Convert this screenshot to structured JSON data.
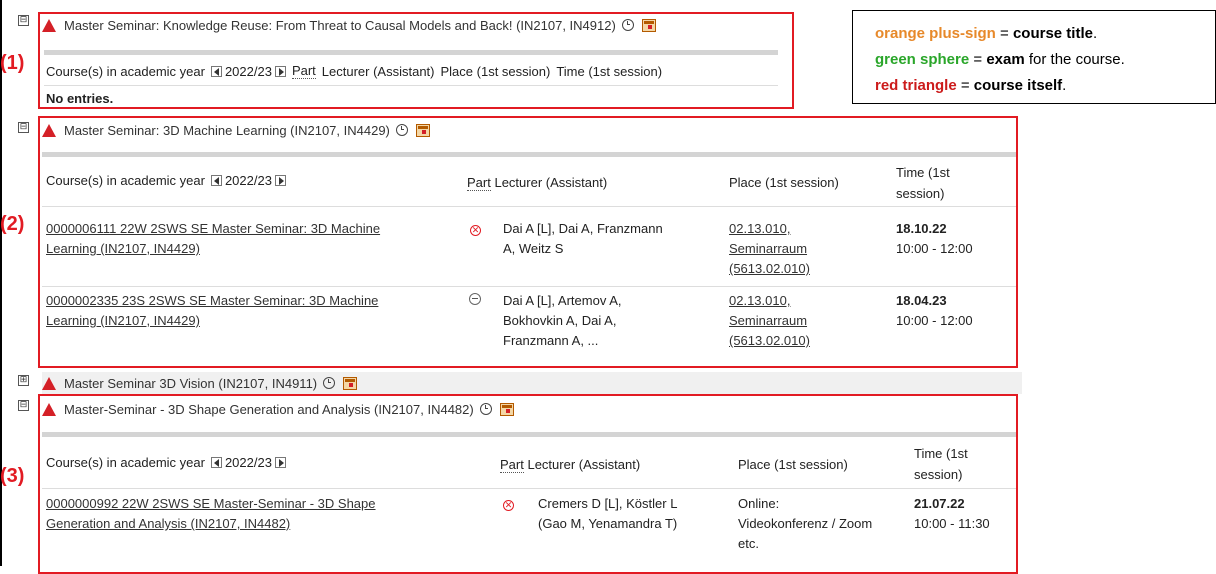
{
  "colors": {
    "accent_red": "#e21b23",
    "orange": "#e7892a",
    "green": "#2aa62a",
    "red_text": "#cc1b1b"
  },
  "icons": {
    "toggle_minus": "minus-square-icon",
    "toggle_plus": "plus-square-icon",
    "triangle": "red-triangle-icon",
    "clock": "clock-icon",
    "calendar": "calendar-icon",
    "year_prev": "arrow-left-icon",
    "year_next": "arrow-right-icon",
    "cancelled": "x-circle-icon",
    "minus_circle": "minus-circle-icon"
  },
  "toggle_minus_symbol": "⊟",
  "toggle_plus_symbol": "⊞",
  "markers": [
    "(1)",
    "(2)",
    "(3)"
  ],
  "legend": {
    "line1": {
      "term": "orange plus-sign",
      "eq": " = ",
      "def": "course title",
      "end": "."
    },
    "line2": {
      "term": "green sphere",
      "eq": " = ",
      "def": "exam",
      "rest": " for the course."
    },
    "line3": {
      "term": "red triangle",
      "eq": " = ",
      "def": "course itself",
      "end": "."
    }
  },
  "table_headers": {
    "courses": "Course(s) in academic year",
    "year": "2022/23",
    "part": "Part",
    "lecturer": "Lecturer (Assistant)",
    "place": "Place (1st session)",
    "time": "Time (1st session)",
    "time_line1": "Time (1st",
    "time_line2": "session)"
  },
  "modules": [
    {
      "title": "Master Seminar: Knowledge Reuse: From Threat to Causal Models and Back! (IN2107, IN4912)",
      "empty_text": "No entries."
    },
    {
      "title": "Master Seminar: 3D Machine Learning (IN2107, IN4429)",
      "rows": [
        {
          "course_line1": "0000006111 22W 2SWS SE Master Seminar: 3D Machine",
          "course_line2": "Learning (IN2107, IN4429)",
          "lecturer_line1": "Dai A [L], Dai A, Franzmann",
          "lecturer_line2": "A, Weitz S",
          "place_line1": "02.13.010,",
          "place_line2": "Seminarraum",
          "place_line3": "(5613.02.010)",
          "date": "18.10.22",
          "time": "10:00 - 12:00"
        },
        {
          "course_line1": "0000002335 23S 2SWS SE Master Seminar: 3D Machine",
          "course_line2": "Learning (IN2107, IN4429)",
          "lecturer_line1": "Dai A [L], Artemov A,",
          "lecturer_line2": "Bokhovkin A, Dai A,",
          "lecturer_line3": "Franzmann A, ...",
          "place_line1": "02.13.010,",
          "place_line2": "Seminarraum",
          "place_line3": "(5613.02.010)",
          "date": "18.04.23",
          "time": "10:00 - 12:00"
        }
      ]
    },
    {
      "title": "Master Seminar 3D Vision (IN2107, IN4911)"
    },
    {
      "title": "Master-Seminar - 3D Shape Generation and Analysis (IN2107, IN4482)",
      "rows": [
        {
          "course_line1": "0000000992 22W 2SWS SE Master-Seminar - 3D Shape",
          "course_line2": "Generation and Analysis (IN2107, IN4482)",
          "lecturer_line1": "Cremers D [L], Köstler L",
          "lecturer_line2": "(Gao M, Yenamandra T)",
          "place_line1": "Online:",
          "place_line2": "Videokonferenz / Zoom",
          "place_line3": "etc.",
          "date": "21.07.22",
          "time": "10:00 - 11:30"
        }
      ]
    }
  ]
}
